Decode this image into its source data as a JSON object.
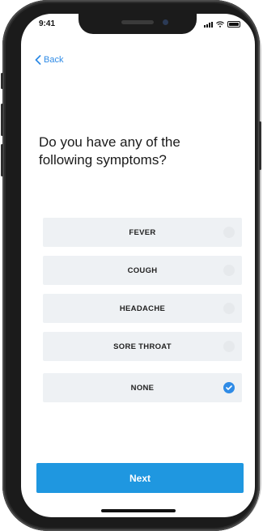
{
  "status_bar": {
    "time": "9:41"
  },
  "nav": {
    "back_label": "Back"
  },
  "question": {
    "text": "Do you have any of the following symptoms?"
  },
  "options": [
    {
      "label": "FEVER",
      "selected": false
    },
    {
      "label": "COUGH",
      "selected": false
    },
    {
      "label": "HEADACHE",
      "selected": false
    },
    {
      "label": "SORE THROAT",
      "selected": false
    },
    {
      "label": "NONE",
      "selected": true
    }
  ],
  "actions": {
    "next_label": "Next"
  },
  "colors": {
    "accent": "#1f97e0",
    "link": "#2f8be6",
    "option_bg": "#eef1f4"
  },
  "icons": {
    "back": "chevron-left-icon",
    "selected": "checkmark-circle-icon"
  }
}
